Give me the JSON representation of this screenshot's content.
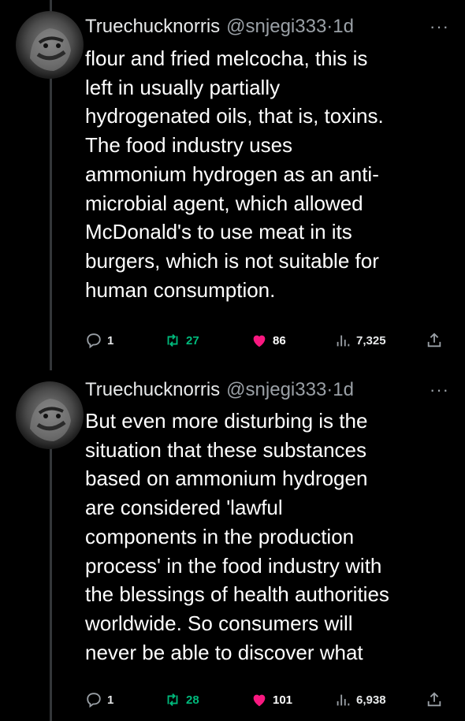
{
  "tweets": [
    {
      "name": "Truechucknorris",
      "handle": "@snjegi333",
      "sep": "·",
      "time": "1d",
      "more": "···",
      "lines": [
        "flour and fried melcocha, this is",
        "left in usually partially",
        "hydrogenated oils, that is, toxins.",
        "The food industry uses",
        "ammonium hydrogen as an anti-",
        "microbial agent, which allowed",
        "McDonald's to use meat in its",
        "burgers, which is not suitable for",
        "human consumption."
      ],
      "replies": "1",
      "retweets": "27",
      "likes": "86",
      "views": "7,325"
    },
    {
      "name": "Truechucknorris",
      "handle": "@snjegi333",
      "sep": "·",
      "time": "1d",
      "more": "···",
      "lines": [
        "But even more disturbing is the",
        "situation that these substances",
        "based on ammonium hydrogen",
        "are considered 'lawful",
        "components in the production",
        "process' in the food industry with",
        "the blessings of health authorities",
        "worldwide. So consumers will",
        "never be able to discover what"
      ],
      "replies": "1",
      "retweets": "28",
      "likes": "101",
      "views": "6,938"
    }
  ],
  "icons": {
    "reply": "reply-icon",
    "retweet": "retweet-icon",
    "like": "heart-icon",
    "views": "views-icon",
    "share": "share-icon"
  },
  "colors": {
    "retweet": "#00ba7c",
    "like": "#f91880",
    "muted": "#9aa0a6"
  }
}
